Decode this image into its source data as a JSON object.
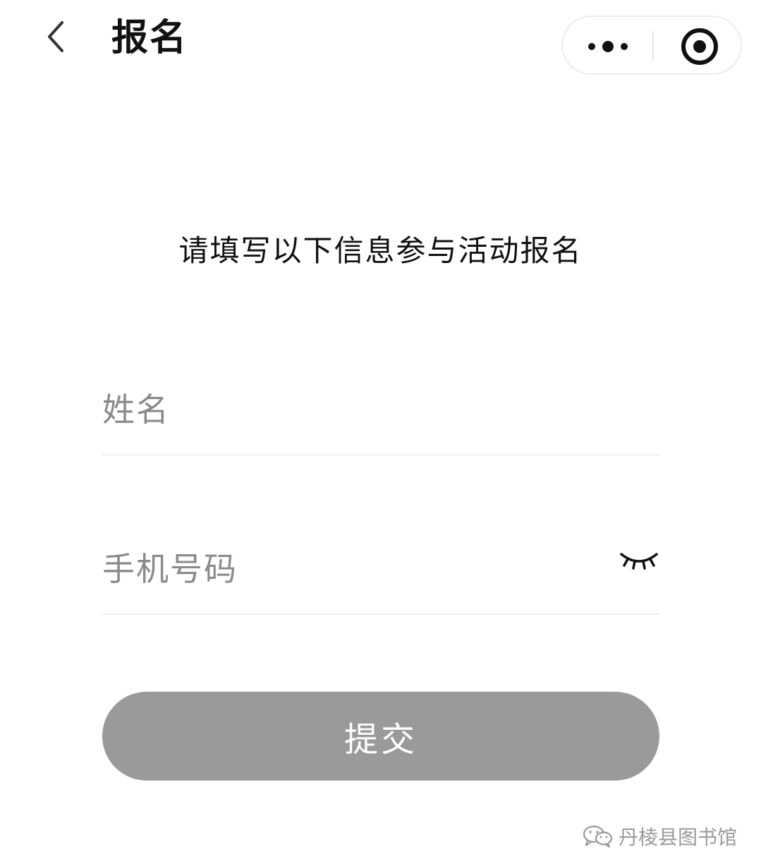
{
  "header": {
    "title": "报名"
  },
  "intro": {
    "text": "请填写以下信息参与活动报名"
  },
  "form": {
    "name_placeholder": "姓名",
    "phone_placeholder": "手机号码",
    "submit_label": "提交"
  },
  "watermark": {
    "text": "丹棱县图书馆"
  },
  "colors": {
    "submit_bg": "#9a9a9a",
    "placeholder": "#8a8a8a",
    "title": "#111111"
  },
  "icons": {
    "back": "chevron-left-icon",
    "more": "more-dots-icon",
    "close": "target-circle-icon",
    "eye": "eye-closed-icon",
    "watermark": "wechat-icon"
  }
}
